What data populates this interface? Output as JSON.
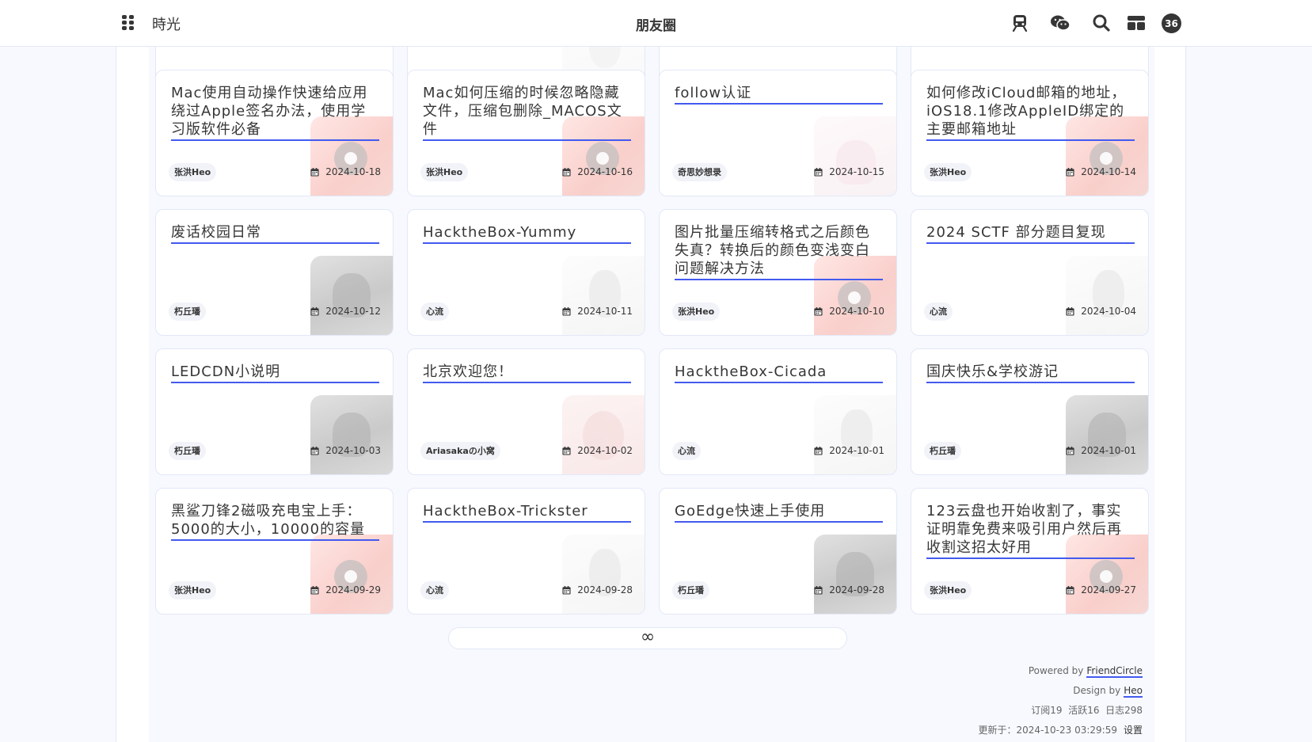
{
  "header": {
    "site_name": "時光",
    "title": "朋友圈",
    "badge_count": "36"
  },
  "icons": {
    "menu": "grid-dots-icon",
    "subway": "subway-icon",
    "wechat": "wechat-icon",
    "search": "search-icon",
    "layout": "layout-icon"
  },
  "colors": {
    "accent": "#425aef",
    "background": "#f7f9fe",
    "card": "#ffffff",
    "text": "#363636"
  },
  "cards": [
    {
      "title": "Mac使用自动操作快速给应用绕过Apple签名办法，使用学习版软件必备",
      "author": "张洪Heo",
      "date": "2024-10-18",
      "avatar": "heo"
    },
    {
      "title": "Mac如何压缩的时候忽略隐藏文件，压缩包删除_MACOS文件",
      "author": "张洪Heo",
      "date": "2024-10-16",
      "avatar": "heo"
    },
    {
      "title": "follow认证",
      "author": "奇思妙想录",
      "date": "2024-10-15",
      "avatar": "cat"
    },
    {
      "title": "如何修改iCloud邮箱的地址，iOS18.1修改AppleID绑定的主要邮箱地址",
      "author": "张洪Heo",
      "date": "2024-10-14",
      "avatar": "heo"
    },
    {
      "title": "废话校园日常",
      "author": "朽丘璠",
      "date": "2024-10-12",
      "avatar": "dark"
    },
    {
      "title": "HacktheBox-Yummy",
      "author": "心流",
      "date": "2024-10-11",
      "avatar": "light"
    },
    {
      "title": "图片批量压缩转格式之后颜色失真？转换后的颜色变浅变白问题解决方法",
      "author": "张洪Heo",
      "date": "2024-10-10",
      "avatar": "heo"
    },
    {
      "title": "2024 SCTF 部分题目复现",
      "author": "心流",
      "date": "2024-10-04",
      "avatar": "light"
    },
    {
      "title": "LEDCDN小说明",
      "author": "朽丘璠",
      "date": "2024-10-03",
      "avatar": "dark"
    },
    {
      "title": "北京欢迎您！",
      "author": "Ariasakaの小窝",
      "date": "2024-10-02",
      "avatar": "red"
    },
    {
      "title": "HacktheBox-Cicada",
      "author": "心流",
      "date": "2024-10-01",
      "avatar": "light"
    },
    {
      "title": "国庆快乐&学校游记",
      "author": "朽丘璠",
      "date": "2024-10-01",
      "avatar": "dark"
    },
    {
      "title": "黑鲨刀锋2磁吸充电宝上手：5000的大小，10000的容量",
      "author": "张洪Heo",
      "date": "2024-09-29",
      "avatar": "heo"
    },
    {
      "title": "HacktheBox-Trickster",
      "author": "心流",
      "date": "2024-09-28",
      "avatar": "light"
    },
    {
      "title": "GoEdge快速上手使用",
      "author": "朽丘璠",
      "date": "2024-09-28",
      "avatar": "dark"
    },
    {
      "title": "123云盘也开始收割了，事实证明靠免费来吸引用户然后再收割这招太好用",
      "author": "张洪Heo",
      "date": "2024-09-27",
      "avatar": "heo"
    }
  ],
  "load_more": "∞",
  "footer": {
    "powered_label": "Powered by",
    "powered_link": "FriendCircle",
    "design_label": "Design by",
    "design_link": "Heo",
    "stats": "订阅19  活跃16  日志298",
    "updated": "更新于：2024-10-23 03:29:59",
    "settings": "设置"
  }
}
